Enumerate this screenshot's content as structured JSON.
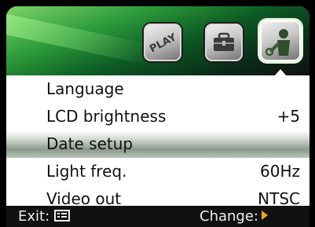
{
  "tabs": [
    {
      "label": "PLAY",
      "icon": "play-icon",
      "active": false
    },
    {
      "label": "",
      "icon": "toolbox-icon",
      "active": false
    },
    {
      "label": "",
      "icon": "wrench-person-icon",
      "active": true
    }
  ],
  "menu": {
    "items": [
      {
        "label": "Language",
        "value": "",
        "selected": false
      },
      {
        "label": "LCD brightness",
        "value": "+5",
        "selected": false
      },
      {
        "label": "Date setup",
        "value": "",
        "selected": true
      },
      {
        "label": "Light freq.",
        "value": "60Hz",
        "selected": false
      },
      {
        "label": "Video out",
        "value": "NTSC",
        "selected": false
      }
    ]
  },
  "footer": {
    "exit_label": "Exit:",
    "change_label": "Change:"
  },
  "colors": {
    "accent": "#f3a51a",
    "header_green": "#2c9b3a",
    "footer_bg": "#111111"
  }
}
